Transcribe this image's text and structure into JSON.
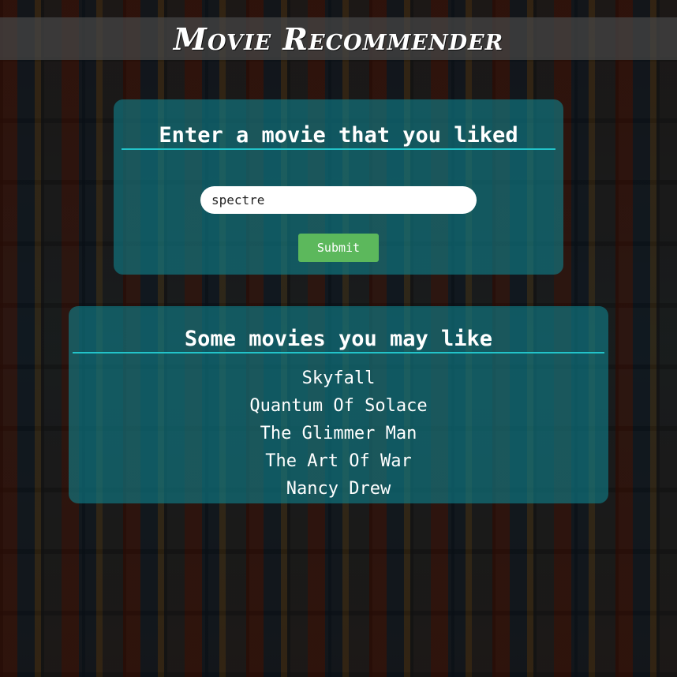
{
  "header": {
    "title": "Movie Recommender"
  },
  "input_card": {
    "heading": "Enter a movie that you liked",
    "search_value": "spectre",
    "submit_label": "Submit"
  },
  "results_card": {
    "heading": "Some movies you may like",
    "movies": [
      "Skyfall",
      "Quantum Of Solace",
      "The Glimmer Man",
      "The Art Of War",
      "Nancy Drew"
    ]
  },
  "colors": {
    "card_background": "#10808a",
    "heading_rule": "#22c3c9",
    "submit_button": "#5cb85c",
    "text": "#ffffff"
  }
}
